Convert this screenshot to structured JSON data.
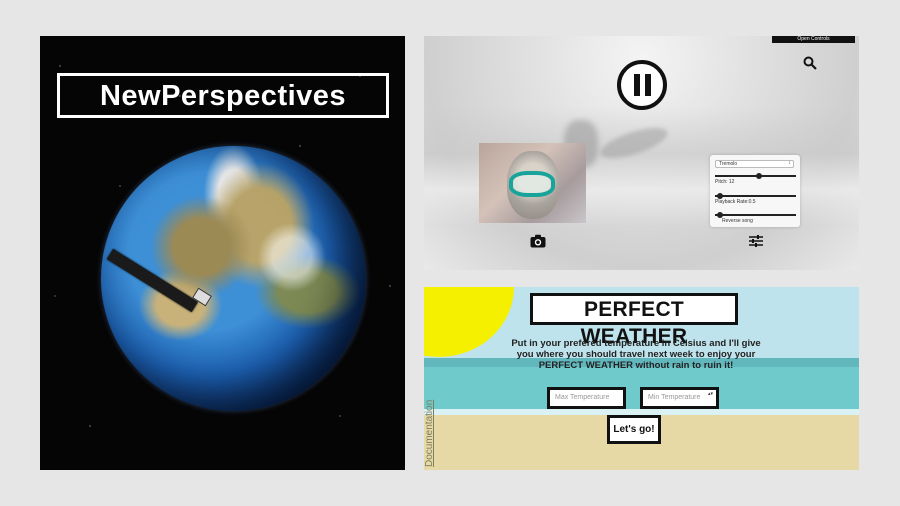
{
  "left_panel": {
    "title": "NewPerspectives"
  },
  "video_panel": {
    "open_controls_label": "Open Controls",
    "icons": {
      "search": "search-icon",
      "pause": "pause-icon",
      "camera": "camera-icon",
      "controls": "sliders-icon"
    },
    "controls": {
      "effect_select": "Tremolo",
      "pitch_label": "Pitch: 12",
      "playback_label": "Playback Rate:0.5",
      "reverse_label": "Reverse song",
      "pitch_level": 0.55,
      "playback_level": 0.02,
      "reverse_level": 0.02
    }
  },
  "weather_panel": {
    "title": "PERFECT WEATHER",
    "description": "Put in your prefered temperature in Celsius and I'll give you where you should travel next week to enjoy your PERFECT WEATHER without rain to ruin it!",
    "max_placeholder": "Max Temperature",
    "min_placeholder": "Min Temperature",
    "go_label": "Let's go!",
    "doc_link": "Documentation",
    "colors": {
      "sun": "#f4f000",
      "sky": "#bfe3ec",
      "sea": "#6fcacb",
      "sand": "#e7d9a6"
    }
  }
}
